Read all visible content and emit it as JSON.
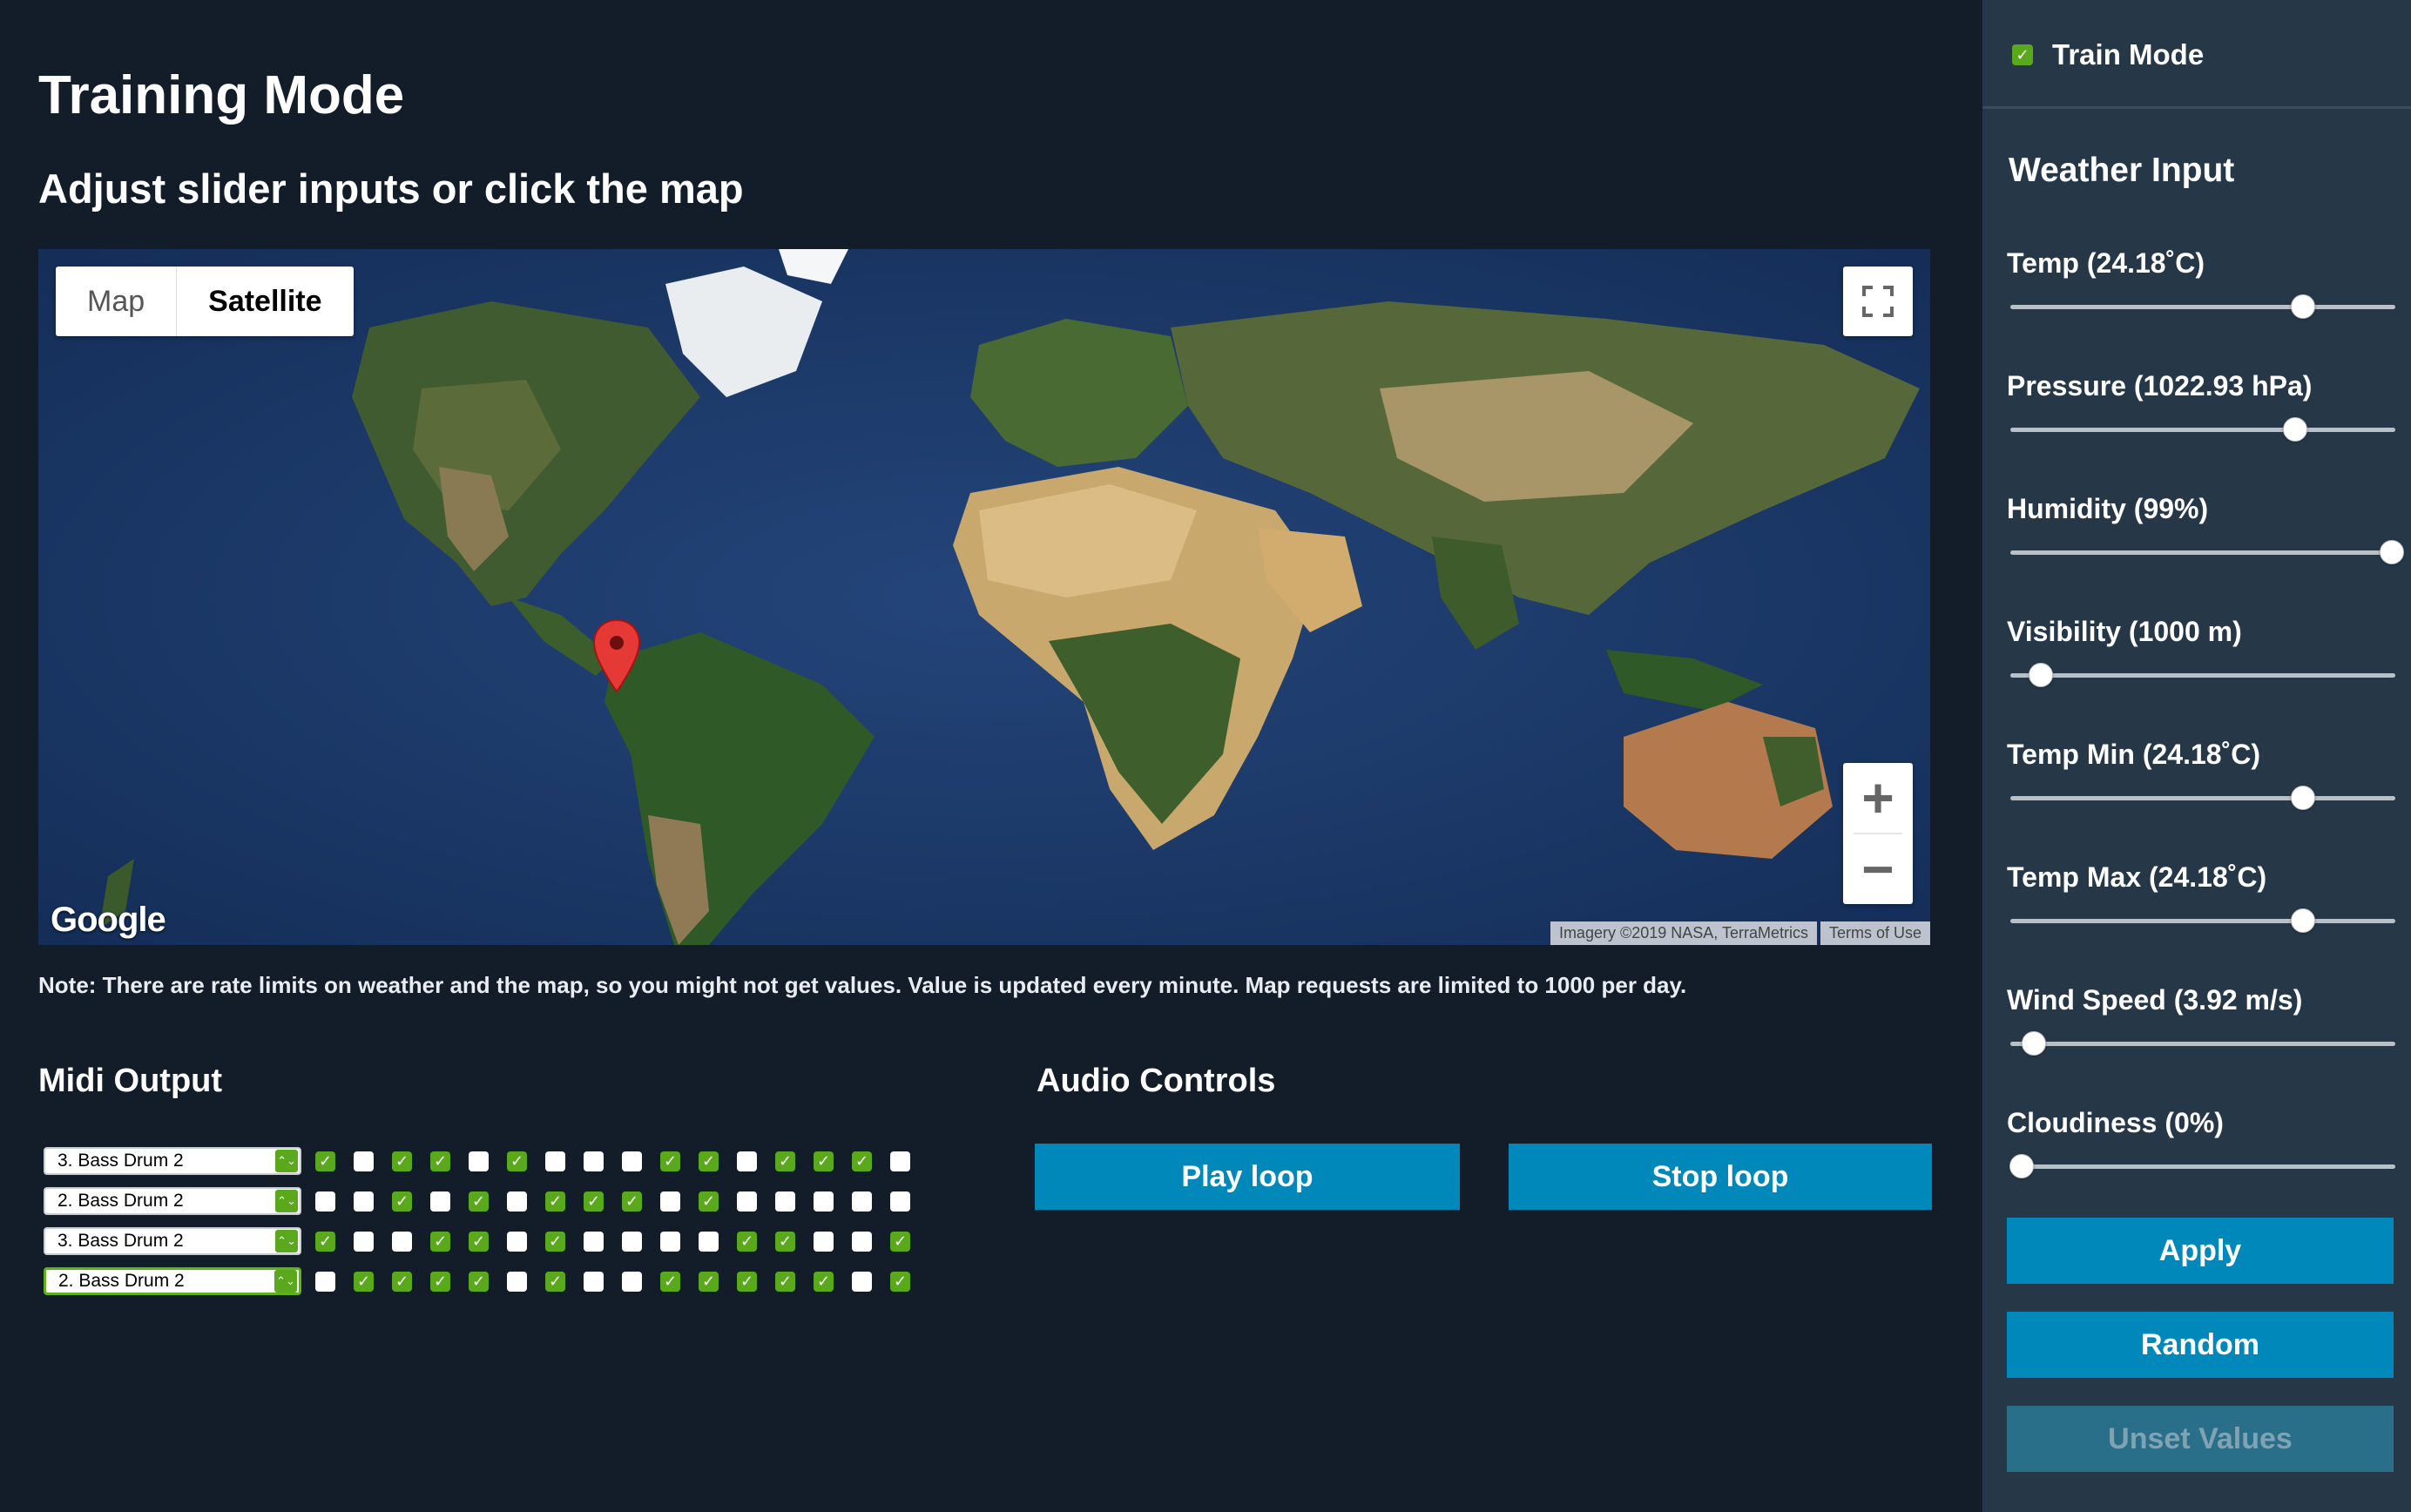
{
  "page": {
    "title": "Training Mode",
    "subtitle": "Adjust slider inputs or click the map",
    "note": "Note: There are rate limits on weather and the map, so you might not get values. Value is updated every minute. Map requests are limited to 1000 per day."
  },
  "map": {
    "type_options": [
      "Map",
      "Satellite"
    ],
    "selected_type": "Satellite",
    "zoom_in": "+",
    "zoom_out": "−",
    "logo": "Google",
    "imagery_credit": "Imagery ©2019 NASA, TerraMetrics",
    "terms": "Terms of Use",
    "icons": [
      "fullscreen-icon",
      "map-pin-icon"
    ]
  },
  "midi": {
    "title": "Midi Output",
    "rows": [
      {
        "instrument": "3. Bass Drum 2",
        "steps": [
          1,
          0,
          1,
          1,
          0,
          1,
          0,
          0,
          0,
          1,
          1,
          0,
          1,
          1,
          1,
          0
        ]
      },
      {
        "instrument": "2. Bass Drum 2",
        "steps": [
          0,
          0,
          1,
          0,
          1,
          0,
          1,
          1,
          1,
          0,
          1,
          0,
          0,
          0,
          0,
          0
        ]
      },
      {
        "instrument": "3. Bass Drum 2",
        "steps": [
          1,
          0,
          0,
          1,
          1,
          0,
          1,
          0,
          0,
          0,
          0,
          1,
          1,
          0,
          0,
          1
        ]
      },
      {
        "instrument": "2. Bass Drum 2",
        "steps": [
          0,
          1,
          1,
          1,
          1,
          0,
          1,
          0,
          0,
          1,
          1,
          1,
          1,
          1,
          0,
          1
        ]
      }
    ]
  },
  "audio": {
    "title": "Audio Controls",
    "play_label": "Play loop",
    "stop_label": "Stop loop"
  },
  "sidebar": {
    "train_mode_label": "Train Mode",
    "train_mode_checked": true,
    "weather_title": "Weather Input",
    "sliders": [
      {
        "label": "Temp (24.18˚C)",
        "fraction": 0.76
      },
      {
        "label": "Pressure (1022.93 hPa)",
        "fraction": 0.74
      },
      {
        "label": "Humidity (99%)",
        "fraction": 0.99
      },
      {
        "label": "Visibility (1000 m)",
        "fraction": 0.08
      },
      {
        "label": "Temp Min (24.18˚C)",
        "fraction": 0.76
      },
      {
        "label": "Temp Max (24.18˚C)",
        "fraction": 0.76
      },
      {
        "label": "Wind Speed (3.92 m/s)",
        "fraction": 0.06
      },
      {
        "label": "Cloudiness (0%)",
        "fraction": 0.03
      }
    ],
    "apply_label": "Apply",
    "random_label": "Random",
    "unset_label": "Unset Values"
  },
  "colors": {
    "background": "#121d29",
    "sidebar": "#263848",
    "button": "#0088bb",
    "checkbox_on": "#5aa91d",
    "pin": "#e53935"
  }
}
